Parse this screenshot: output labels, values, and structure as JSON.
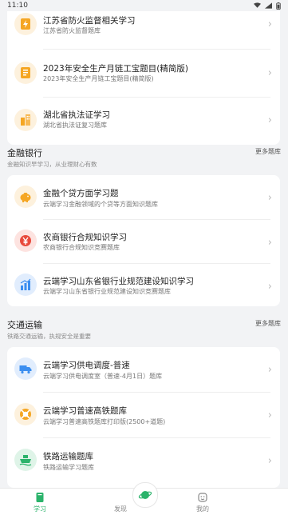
{
  "status_bar": {
    "time": "11:10"
  },
  "card1": {
    "items": [
      {
        "title": "江苏省防火监督相关学习",
        "subtitle": "江苏省防火监督题库",
        "icon": "bolt-document-icon",
        "color": "#f5a623"
      },
      {
        "title": "2023年安全生产月链工宝题目(精简版)",
        "subtitle": "2023年安全生产月链工宝题目(精简版)",
        "icon": "notebook-icon",
        "color": "#f5a623"
      },
      {
        "title": "湖北省执法证学习",
        "subtitle": "湖北省执法证复习题库",
        "icon": "building-icon",
        "color": "#f5a623"
      }
    ]
  },
  "finance": {
    "title": "金融银行",
    "subtitle": "金融知识早学习，从业理财心有数",
    "more": "更多题库",
    "items": [
      {
        "title": "金融个贷方面学习题",
        "subtitle": "云端学习金融领域的个贷等方面知识题库",
        "icon": "piggy-bank-icon",
        "color": "#f5a623"
      },
      {
        "title": "农商银行合规知识学习",
        "subtitle": "农商银行合规知识竞赛题库",
        "icon": "yuan-coin-icon",
        "color": "#e84a3c"
      },
      {
        "title": "云端学习山东省银行业规范建设知识学习",
        "subtitle": "云端学习山东省银行业规范建设知识竞赛题库",
        "icon": "bar-chart-icon",
        "color": "#3b8ef0"
      }
    ]
  },
  "transport": {
    "title": "交通运输",
    "subtitle": "铁路交通运输，执规安全是重要",
    "more": "更多题库",
    "items": [
      {
        "title": "云端学习供电调度-普速",
        "subtitle": "云端学习供电调度室（普速-4月1日）题库",
        "icon": "truck-icon",
        "color": "#3b8ef0"
      },
      {
        "title": "云端学习普速高铁题库",
        "subtitle": "云端学习普速高铁题库打印版(2500+道题)",
        "icon": "lifebuoy-icon",
        "color": "#f5a623"
      },
      {
        "title": "铁路运输题库",
        "subtitle": "铁路运输学习题库",
        "icon": "ship-icon",
        "color": "#2bb36b"
      }
    ]
  },
  "tabbar": {
    "tabs": [
      {
        "label": "学习",
        "icon": "book-icon"
      },
      {
        "label": "发现",
        "icon": "planet-icon"
      },
      {
        "label": "我的",
        "icon": "face-icon"
      }
    ]
  }
}
